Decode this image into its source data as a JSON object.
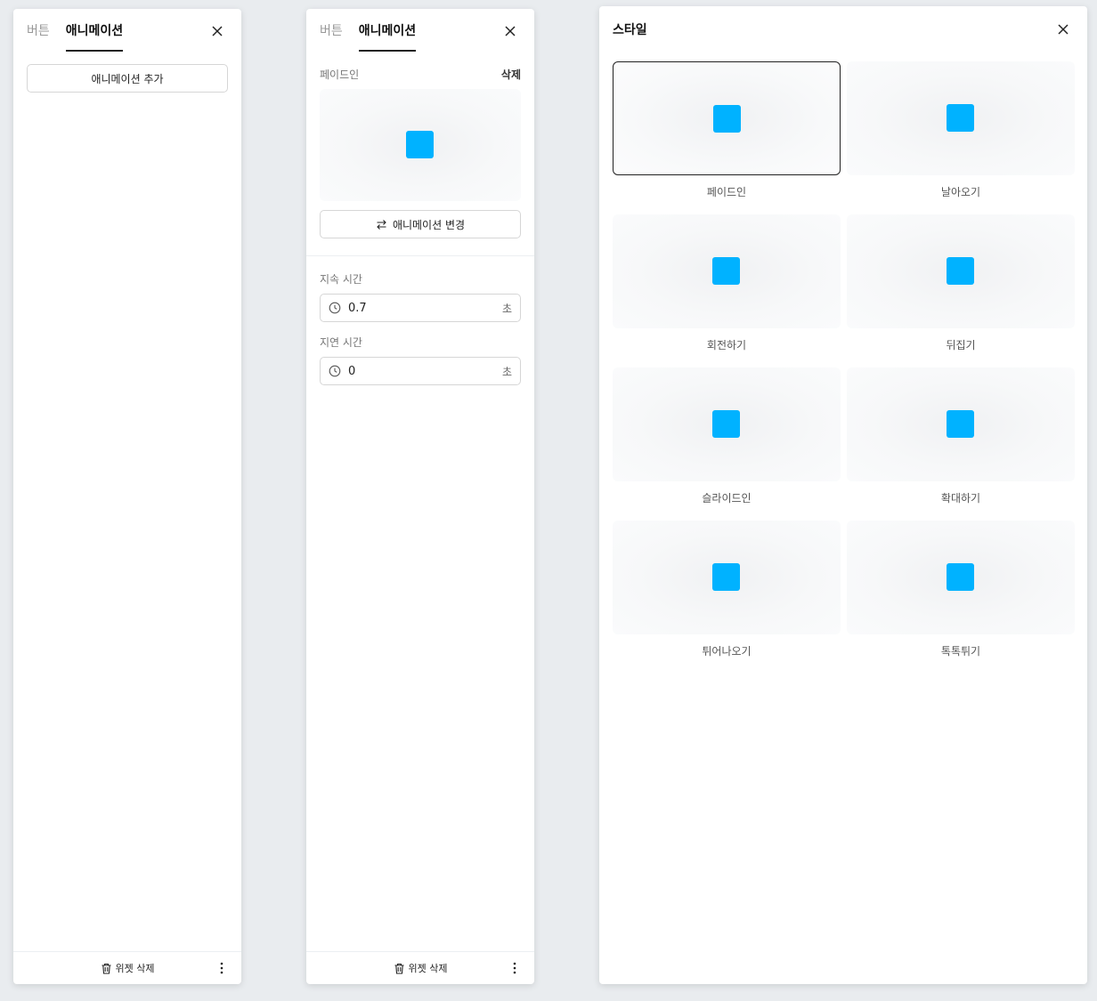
{
  "panel1": {
    "tabs": [
      {
        "label": "버튼"
      },
      {
        "label": "애니메이션"
      }
    ],
    "add_animation_label": "애니메이션 추가",
    "footer": {
      "delete_widget_label": "위젯 삭제"
    }
  },
  "panel2": {
    "tabs": [
      {
        "label": "버튼"
      },
      {
        "label": "애니메이션"
      }
    ],
    "animation_name": "페이드인",
    "delete_label": "삭제",
    "change_animation_label": "애니메이션 변경",
    "duration": {
      "label": "지속 시간",
      "value": "0.7",
      "unit": "초"
    },
    "delay": {
      "label": "지연 시간",
      "value": "0",
      "unit": "초"
    },
    "footer": {
      "delete_widget_label": "위젯 삭제"
    }
  },
  "panel3": {
    "title": "스타일",
    "selected_index": 0,
    "styles": [
      {
        "label": "페이드인"
      },
      {
        "label": "날아오기"
      },
      {
        "label": "회전하기"
      },
      {
        "label": "뒤집기"
      },
      {
        "label": "슬라이드인"
      },
      {
        "label": "확대하기"
      },
      {
        "label": "튀어나오기"
      },
      {
        "label": "톡톡튀기"
      }
    ]
  },
  "colors": {
    "accent": "#00b2ff",
    "background": "#e9ecef"
  },
  "icons": [
    "close-icon",
    "swap-icon",
    "clock-icon",
    "trash-icon",
    "more-vertical-icon"
  ]
}
